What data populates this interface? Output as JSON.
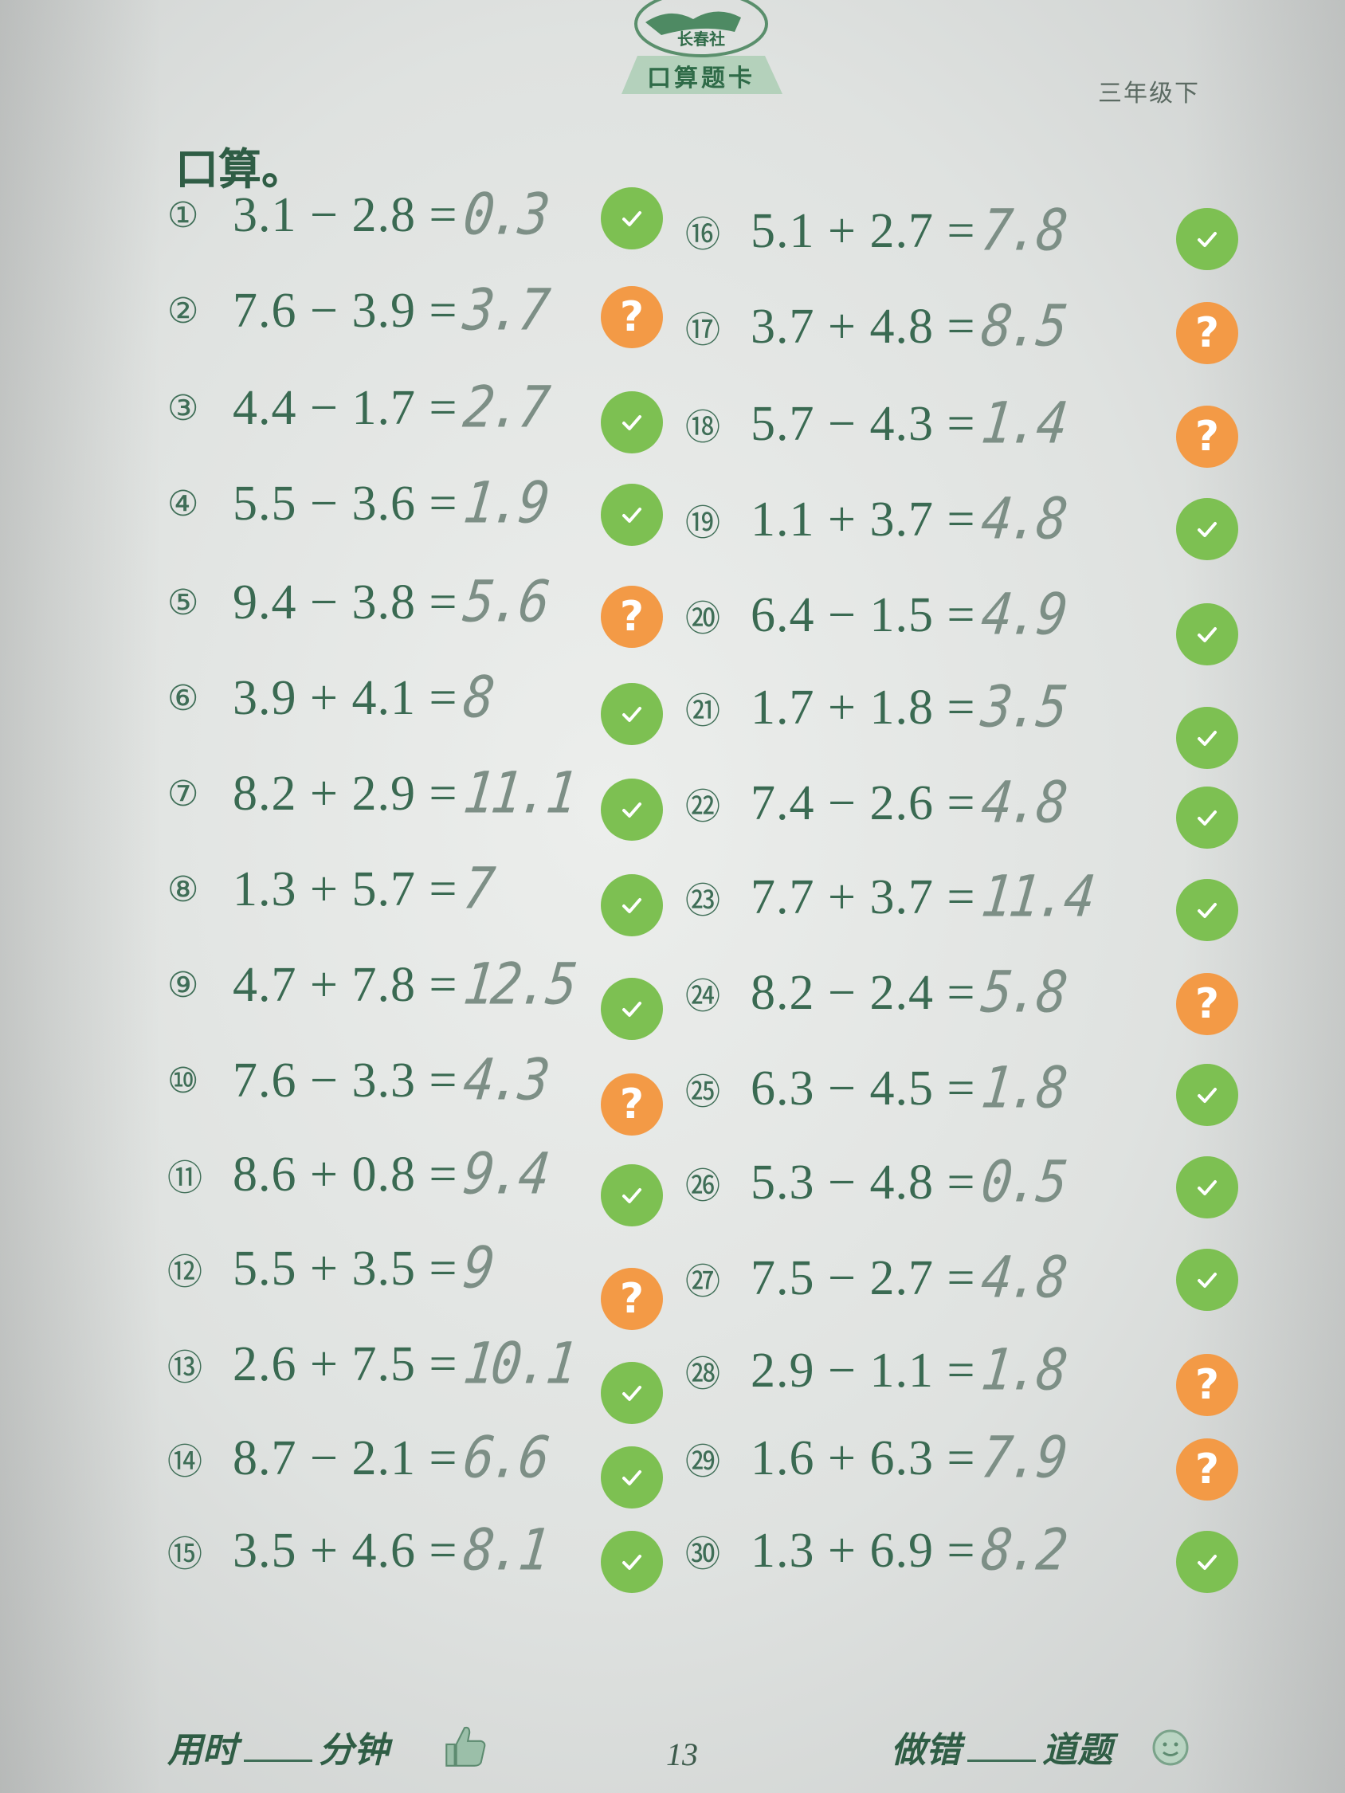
{
  "header": {
    "publisher": "长春社",
    "book_title": "口算题卡",
    "grade": "三年级下"
  },
  "section_title": "口算。",
  "problems": [
    {
      "no": "①",
      "expr": "3.1 − 2.8 =",
      "answer": "0.3",
      "status": "correct"
    },
    {
      "no": "②",
      "expr": "7.6 − 3.9 =",
      "answer": "3.7",
      "status": "uncertain"
    },
    {
      "no": "③",
      "expr": "4.4 − 1.7 =",
      "answer": "2.7",
      "status": "correct"
    },
    {
      "no": "④",
      "expr": "5.5 − 3.6 =",
      "answer": "1.9",
      "status": "correct"
    },
    {
      "no": "⑤",
      "expr": "9.4 − 3.8 =",
      "answer": "5.6",
      "status": "uncertain"
    },
    {
      "no": "⑥",
      "expr": "3.9 + 4.1 =",
      "answer": "8",
      "status": "correct"
    },
    {
      "no": "⑦",
      "expr": "8.2 + 2.9 =",
      "answer": "11.1",
      "status": "correct"
    },
    {
      "no": "⑧",
      "expr": "1.3 + 5.7 =",
      "answer": "7",
      "status": "correct"
    },
    {
      "no": "⑨",
      "expr": "4.7 + 7.8 =",
      "answer": "12.5",
      "status": "correct"
    },
    {
      "no": "⑩",
      "expr": "7.6 − 3.3 =",
      "answer": "4.3",
      "status": "uncertain"
    },
    {
      "no": "⑪",
      "expr": "8.6 + 0.8 =",
      "answer": "9.4",
      "status": "correct"
    },
    {
      "no": "⑫",
      "expr": "5.5 + 3.5 =",
      "answer": "9",
      "status": "uncertain"
    },
    {
      "no": "⑬",
      "expr": "2.6 + 7.5 =",
      "answer": "10.1",
      "status": "correct"
    },
    {
      "no": "⑭",
      "expr": "8.7 − 2.1 =",
      "answer": "6.6",
      "status": "correct"
    },
    {
      "no": "⑮",
      "expr": "3.5 + 4.6 =",
      "answer": "8.1",
      "status": "correct"
    },
    {
      "no": "⑯",
      "expr": "5.1 + 2.7 =",
      "answer": "7.8",
      "status": "correct"
    },
    {
      "no": "⑰",
      "expr": "3.7 + 4.8 =",
      "answer": "8.5",
      "status": "uncertain"
    },
    {
      "no": "⑱",
      "expr": "5.7 − 4.3 =",
      "answer": "1.4",
      "status": "uncertain"
    },
    {
      "no": "⑲",
      "expr": "1.1 + 3.7 =",
      "answer": "4.8",
      "status": "correct"
    },
    {
      "no": "⑳",
      "expr": "6.4 − 1.5 =",
      "answer": "4.9",
      "status": "correct"
    },
    {
      "no": "㉑",
      "expr": "1.7 + 1.8 =",
      "answer": "3.5",
      "status": "correct"
    },
    {
      "no": "㉒",
      "expr": "7.4 − 2.6 =",
      "answer": "4.8",
      "status": "correct"
    },
    {
      "no": "㉓",
      "expr": "7.7 + 3.7 =",
      "answer": "11.4",
      "status": "correct"
    },
    {
      "no": "㉔",
      "expr": "8.2 − 2.4 =",
      "answer": "5.8",
      "status": "uncertain"
    },
    {
      "no": "㉕",
      "expr": "6.3 − 4.5 =",
      "answer": "1.8",
      "status": "correct"
    },
    {
      "no": "㉖",
      "expr": "5.3 − 4.8 =",
      "answer": "0.5",
      "status": "correct"
    },
    {
      "no": "㉗",
      "expr": "7.5 − 2.7 =",
      "answer": "4.8",
      "status": "correct"
    },
    {
      "no": "㉘",
      "expr": "2.9 − 1.1 =",
      "answer": "1.8",
      "status": "uncertain"
    },
    {
      "no": "㉙",
      "expr": "1.6 + 6.3 =",
      "answer": "7.9",
      "status": "uncertain"
    },
    {
      "no": "㉚",
      "expr": "1.3 + 6.9 =",
      "answer": "8.2",
      "status": "correct"
    }
  ],
  "badge_icons": {
    "correct": "check-icon",
    "uncertain": "question-icon"
  },
  "colors": {
    "correct": "#7dc052",
    "uncertain": "#f39a46",
    "print_green": "#3a6a52"
  },
  "footer": {
    "time_label": "用时",
    "minutes_label": "分钟",
    "page_number": "13",
    "errors_label": "做错",
    "count_label": "道题"
  }
}
